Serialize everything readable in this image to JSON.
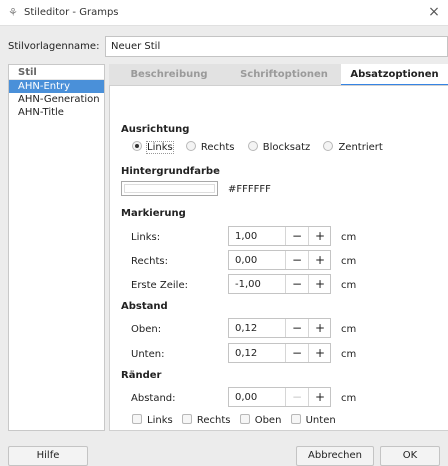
{
  "window": {
    "title": "Stileditor - Gramps",
    "close_glyph": "×",
    "icon_name": "gramps-icon"
  },
  "name_field": {
    "label": "Stilvorlagenname:",
    "value": "Neuer Stil"
  },
  "style_list": {
    "header": "Stil",
    "items": [
      "AHN-Entry",
      "AHN-Generation",
      "AHN-Title"
    ],
    "selected": "AHN-Entry"
  },
  "tabs": [
    "Beschreibung",
    "Schriftoptionen",
    "Absatzoptionen"
  ],
  "active_tab": "Absatzoptionen",
  "alignment": {
    "heading": "Ausrichtung",
    "options": [
      "Links",
      "Rechts",
      "Blocksatz",
      "Zentriert"
    ],
    "selected": "Links"
  },
  "background": {
    "heading": "Hintergrundfarbe",
    "color": "#FFFFFF",
    "color_text": "#FFFFFF"
  },
  "indent": {
    "heading": "Markierung",
    "fields": [
      {
        "label": "Links:",
        "value": "1,00",
        "unit": "cm"
      },
      {
        "label": "Rechts:",
        "value": "0,00",
        "unit": "cm"
      },
      {
        "label": "Erste Zeile:",
        "value": "-1,00",
        "unit": "cm"
      }
    ]
  },
  "spacing": {
    "heading": "Abstand",
    "fields": [
      {
        "label": "Oben:",
        "value": "0,12",
        "unit": "cm"
      },
      {
        "label": "Unten:",
        "value": "0,12",
        "unit": "cm"
      }
    ]
  },
  "borders": {
    "heading": "Ränder",
    "field": {
      "label": "Abstand:",
      "value": "0,00",
      "unit": "cm"
    },
    "checks": [
      "Links",
      "Rechts",
      "Oben",
      "Unten"
    ]
  },
  "spin_glyphs": {
    "minus": "−",
    "plus": "+"
  },
  "buttons": {
    "help": "Hilfe",
    "cancel": "Abbrechen",
    "ok": "OK"
  },
  "colors": {
    "accent": "#3584e4",
    "selection": "#4a90d9"
  }
}
